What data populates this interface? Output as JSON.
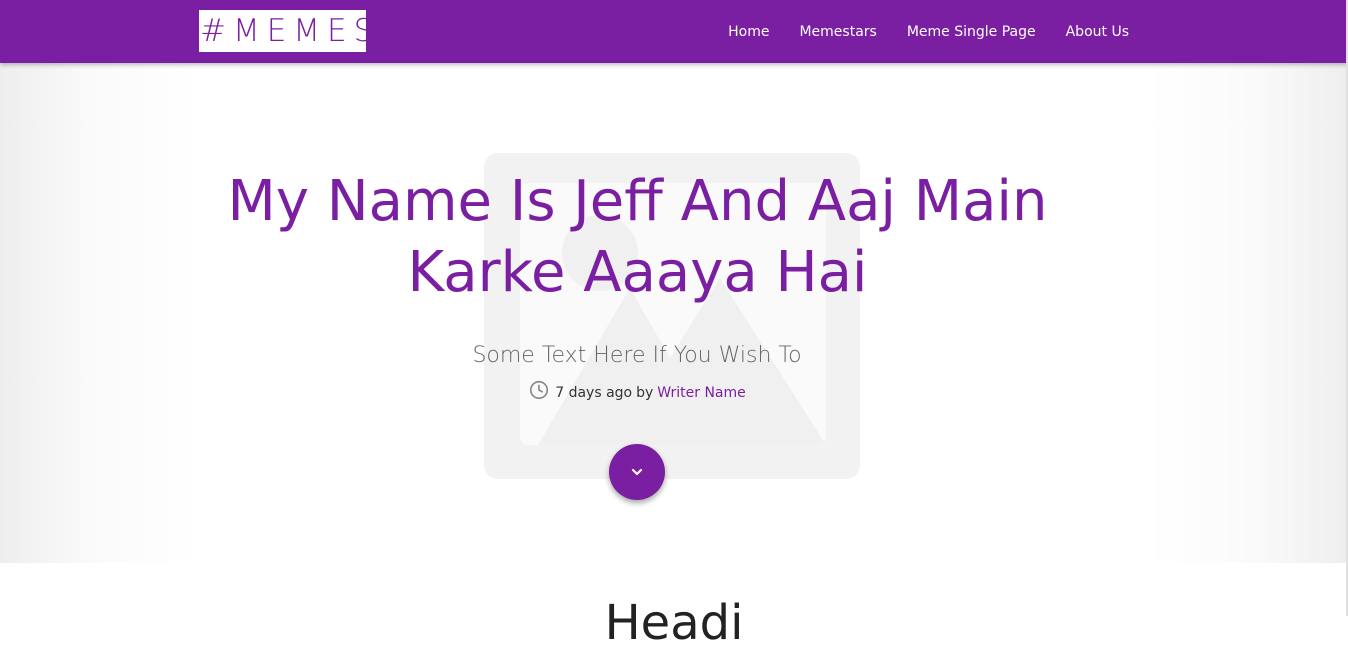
{
  "navbar": {
    "brand": "#MEMES",
    "links": [
      {
        "label": "Home"
      },
      {
        "label": "Memestars"
      },
      {
        "label": "Meme Single Page"
      },
      {
        "label": "About Us"
      }
    ]
  },
  "hero": {
    "title_line1": "My Name Is Jeff And Aaj Main",
    "title_line2": "Karke Aaaya Hai",
    "subtitle": "Some Text Here If You Wish To",
    "meta": {
      "time_text": "7 days ago",
      "by_text": "by",
      "author": "Writer Name"
    },
    "scroll_icon": "chevron-down-icon",
    "background_icon": "image-placeholder-icon"
  },
  "section": {
    "heading_partial": "Headi"
  },
  "colors": {
    "primary": "#7b1fa2",
    "navbar_text": "#ffffff",
    "subtitle": "#666666"
  }
}
